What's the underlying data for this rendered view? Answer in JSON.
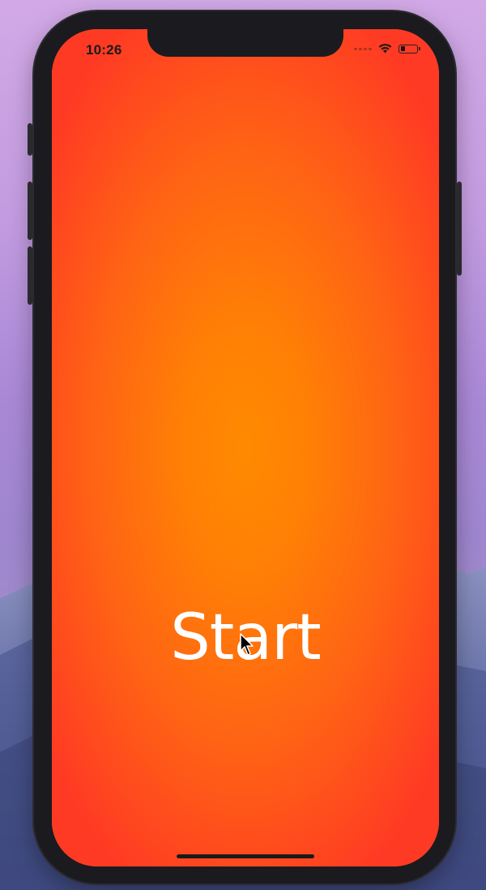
{
  "status_bar": {
    "time": "10:26",
    "icons": [
      "signal-dots-icon",
      "wifi-icon",
      "battery-icon"
    ],
    "battery_level": 0.3
  },
  "main": {
    "start_label": "Start"
  },
  "colors": {
    "gradient_center": "#ff8a00",
    "gradient_edge": "#ff3a24",
    "device_frame": "#1b1a1f",
    "label_text": "#ffffff"
  }
}
